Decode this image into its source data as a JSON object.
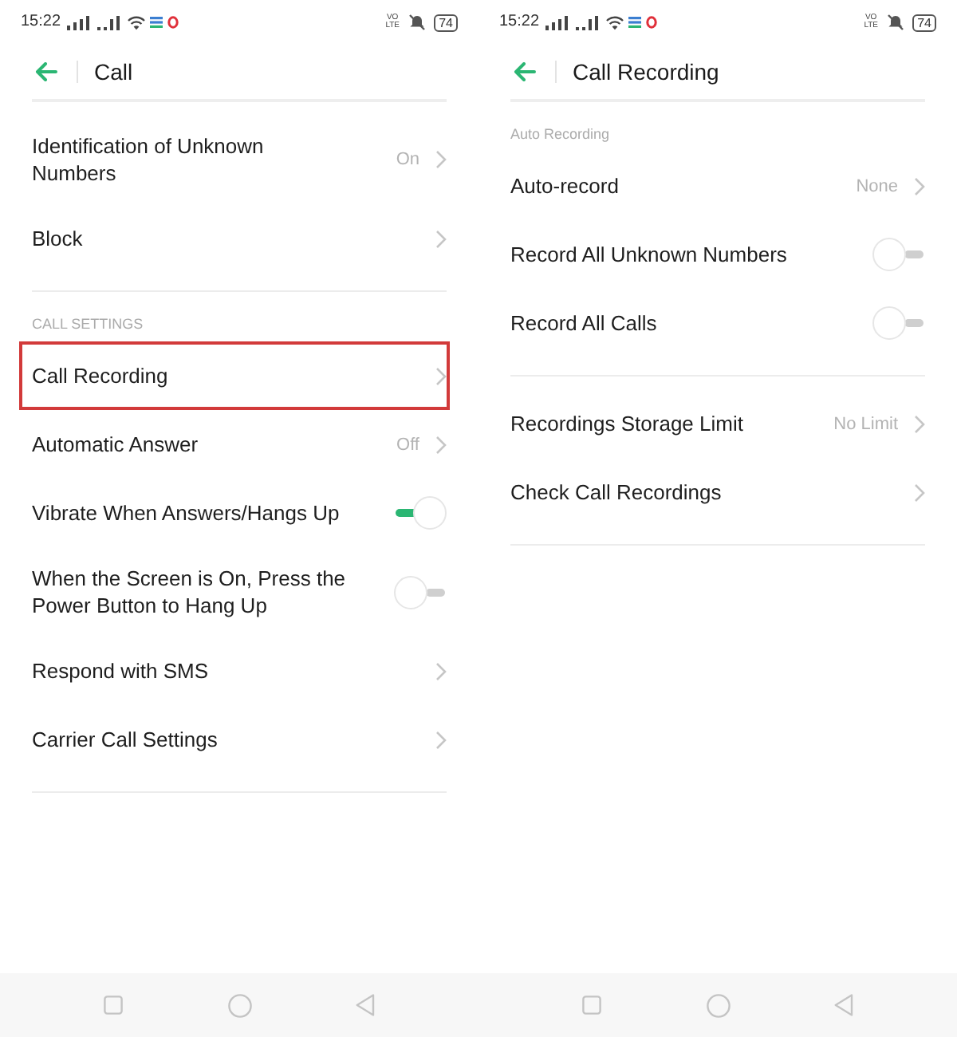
{
  "screens": [
    {
      "status_bar": {
        "time": "15:22",
        "network": "VO LTE",
        "battery": "74"
      },
      "header": {
        "title": "Call"
      },
      "sections": [
        {
          "items": [
            {
              "kind": "link",
              "label": "Identification of Unknown Numbers",
              "value": "On",
              "highlighted": false
            },
            {
              "kind": "link",
              "label": "Block",
              "highlighted": false
            }
          ]
        },
        {
          "label": "CALL SETTINGS",
          "items": [
            {
              "kind": "link",
              "label": "Call Recording",
              "highlighted": true
            },
            {
              "kind": "link",
              "label": "Automatic Answer",
              "value": "Off",
              "highlighted": false
            },
            {
              "kind": "toggle",
              "label": "Vibrate When Answers/Hangs Up",
              "on": true,
              "highlighted": false
            },
            {
              "kind": "toggle",
              "label": "When the Screen is On, Press the Power Button to Hang Up",
              "on": false,
              "highlighted": false
            },
            {
              "kind": "link",
              "label": "Respond with SMS",
              "highlighted": false
            },
            {
              "kind": "link",
              "label": "Carrier Call Settings",
              "highlighted": false
            }
          ]
        }
      ]
    },
    {
      "status_bar": {
        "time": "15:22",
        "network": "VO LTE",
        "battery": "74"
      },
      "header": {
        "title": "Call Recording"
      },
      "sections": [
        {
          "label": "Auto Recording",
          "items": [
            {
              "kind": "link",
              "label": "Auto-record",
              "value": "None",
              "highlighted": false
            },
            {
              "kind": "toggle",
              "label": "Record All Unknown Numbers",
              "on": false,
              "highlighted": false
            },
            {
              "kind": "toggle",
              "label": "Record All Calls",
              "on": false,
              "highlighted": false
            }
          ]
        },
        {
          "items": [
            {
              "kind": "link",
              "label": "Recordings Storage Limit",
              "value": "No Limit",
              "highlighted": false
            },
            {
              "kind": "link",
              "label": "Check Call Recordings",
              "highlighted": false
            }
          ]
        }
      ]
    }
  ]
}
